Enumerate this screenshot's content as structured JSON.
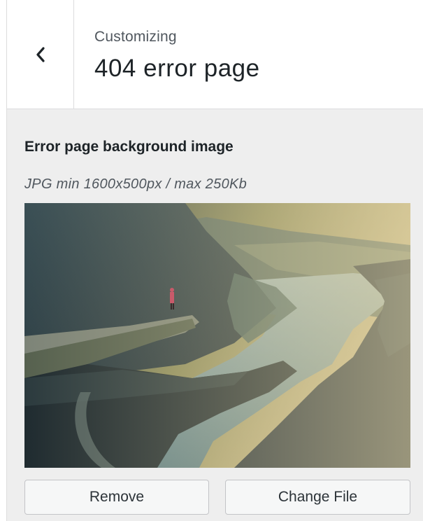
{
  "header": {
    "back_icon": "chevron-left-icon",
    "eyebrow": "Customizing",
    "title": "404 error page"
  },
  "control": {
    "label": "Error page background image",
    "description": "JPG min 1600x500px / max 250Kb"
  },
  "buttons": {
    "remove_label": "Remove",
    "change_label": "Change File"
  },
  "colors": {
    "panel_bg": "#eeeeee",
    "header_bg": "#ffffff",
    "text_dark": "#1d2327",
    "text_muted": "#50575e",
    "button_bg": "#f6f7f7",
    "button_border": "#c3c4c7"
  }
}
